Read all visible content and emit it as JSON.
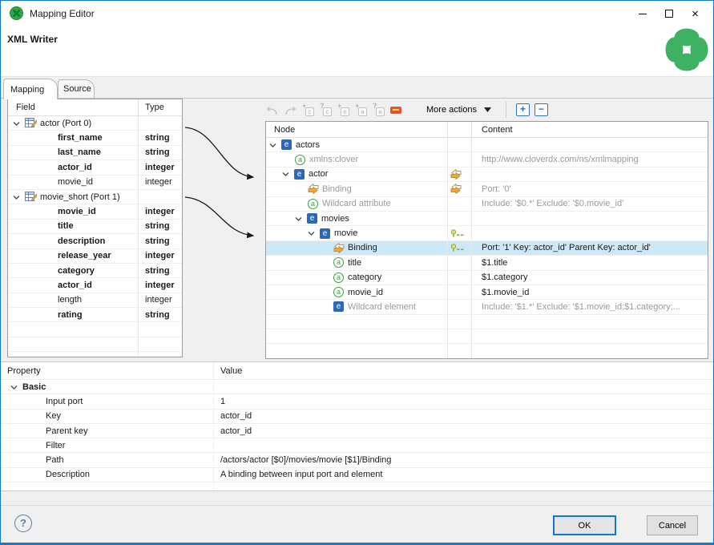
{
  "window": {
    "title": "Mapping Editor"
  },
  "icons": {
    "close": "×",
    "help": "?",
    "expand_all": "+",
    "collapse_all": "−",
    "more_actions_caret": "▼"
  },
  "header": {
    "title": "XML Writer"
  },
  "tabs": {
    "mapping": "Mapping",
    "source": "Source"
  },
  "left_table": {
    "col_field": "Field",
    "col_type": "Type",
    "rows": [
      {
        "field": "actor (Port 0)",
        "type": ""
      },
      {
        "field": "first_name",
        "type": "string"
      },
      {
        "field": "last_name",
        "type": "string"
      },
      {
        "field": "actor_id",
        "type": "integer"
      },
      {
        "field": "movie_id",
        "type": "integer"
      },
      {
        "field": "movie_short (Port 1)",
        "type": ""
      },
      {
        "field": "movie_id",
        "type": "integer"
      },
      {
        "field": "title",
        "type": "string"
      },
      {
        "field": "description",
        "type": "string"
      },
      {
        "field": "release_year",
        "type": "integer"
      },
      {
        "field": "category",
        "type": "string"
      },
      {
        "field": "actor_id",
        "type": "integer"
      },
      {
        "field": "length",
        "type": "integer"
      },
      {
        "field": "rating",
        "type": "string"
      }
    ]
  },
  "toolbar": {
    "more_actions": "More actions",
    "badges": [
      {
        "mark": "+",
        "box": "c"
      },
      {
        "mark": "?",
        "box": "c"
      },
      {
        "mark": "+",
        "box": "e"
      },
      {
        "mark": "+",
        "box": "a"
      },
      {
        "mark": "?",
        "box": "a"
      }
    ]
  },
  "tree": {
    "col_node": "Node",
    "col_content": "Content",
    "rows": [
      {
        "label": "actors",
        "content": ""
      },
      {
        "label": "xmlns:clover",
        "content": "http://www.cloverdx.com/ns/xmlmapping"
      },
      {
        "label": "actor",
        "content": ""
      },
      {
        "label": "Binding",
        "content": "Port: '0'"
      },
      {
        "label": "Wildcard attribute",
        "content": "Include: '$0.*' Exclude: '$0.movie_id'"
      },
      {
        "label": "movies",
        "content": ""
      },
      {
        "label": "movie",
        "content": ""
      },
      {
        "label": "Binding",
        "content": "Port: '1' Key: actor_id' Parent Key: actor_id'"
      },
      {
        "label": "title",
        "content": "$1.title"
      },
      {
        "label": "category",
        "content": "$1.category"
      },
      {
        "label": "movie_id",
        "content": "$1.movie_id"
      },
      {
        "label": "Wildcard element",
        "content": "Include: '$1.*' Exclude: '$1.movie_id;$1.category;..."
      }
    ]
  },
  "properties": {
    "col_property": "Property",
    "col_value": "Value",
    "group": "Basic",
    "rows": [
      {
        "name": "Input port",
        "value": "1"
      },
      {
        "name": "Key",
        "value": "actor_id"
      },
      {
        "name": "Parent key",
        "value": "actor_id"
      },
      {
        "name": "Filter",
        "value": ""
      },
      {
        "name": "Path",
        "value": "/actors/actor [$0]/movies/movie [$1]/Binding"
      },
      {
        "name": "Description",
        "value": "A binding between input port and element"
      }
    ]
  },
  "footer": {
    "ok": "OK",
    "cancel": "Cancel"
  },
  "colors": {
    "accent": "#0f78d0",
    "clover_green": "#3db263",
    "selection": "#cde8f7",
    "binding_orange": "#eda93c",
    "element_blue": "#2e66b8",
    "attribute_green": "#3f9e46"
  }
}
